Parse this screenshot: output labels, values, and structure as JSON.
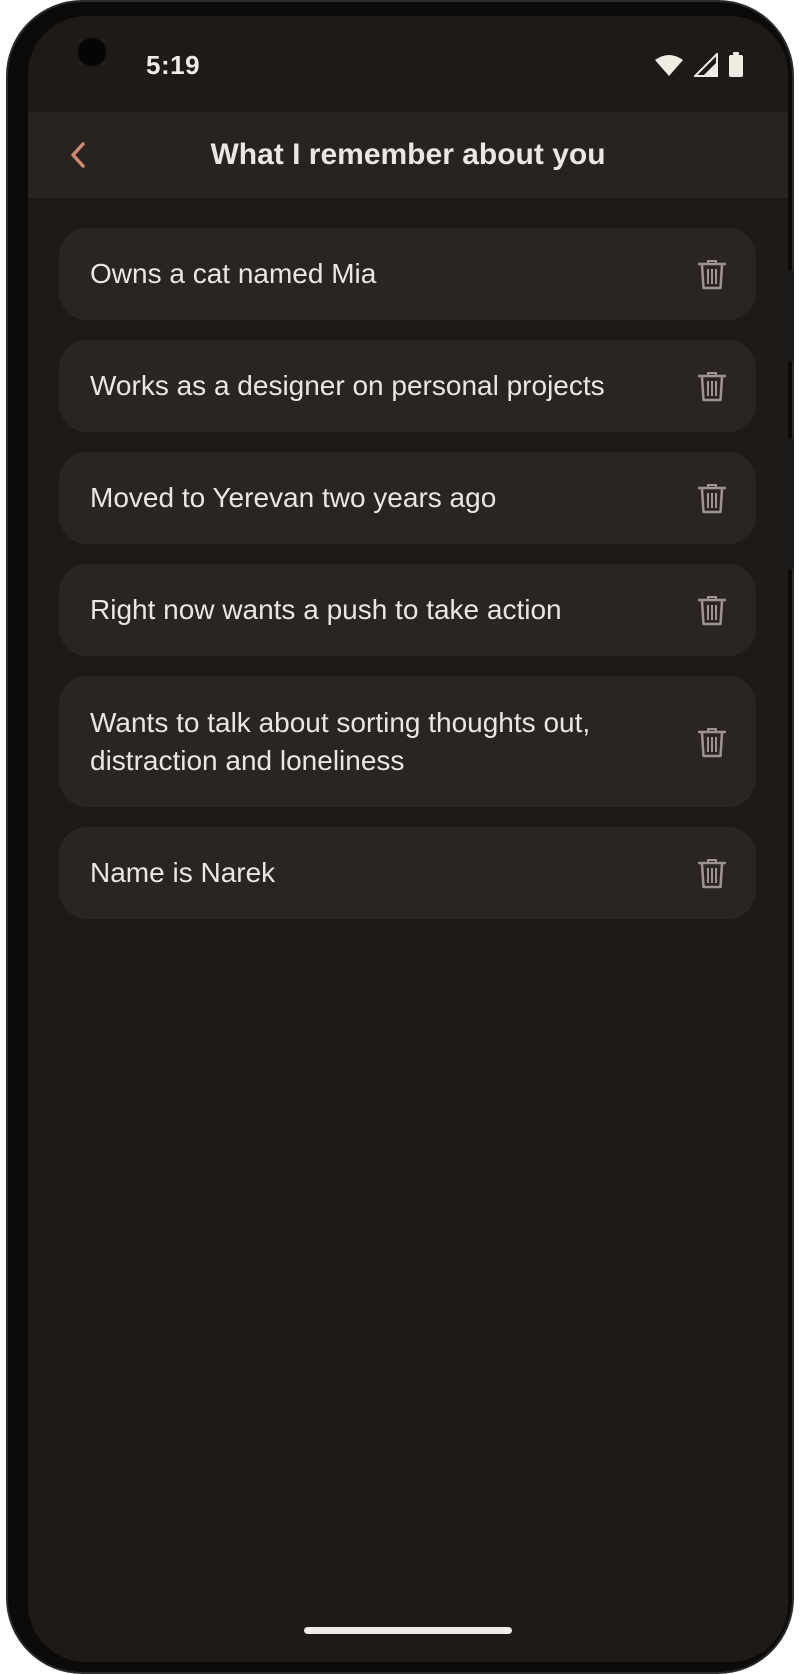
{
  "status_bar": {
    "time": "5:19",
    "icons": [
      "wifi-icon",
      "signal-icon",
      "battery-icon"
    ]
  },
  "app_bar": {
    "back_icon": "chevron-left-icon",
    "title": "What I remember about you"
  },
  "memories": [
    {
      "text": "Owns a cat named Mia",
      "action_icon": "trash-icon"
    },
    {
      "text": "Works as a designer on personal projects",
      "action_icon": "trash-icon"
    },
    {
      "text": "Moved to Yerevan two years ago",
      "action_icon": "trash-icon"
    },
    {
      "text": "Right now wants a push to take action",
      "action_icon": "trash-icon"
    },
    {
      "text": "Wants to talk about sorting thoughts out, distraction and loneliness",
      "action_icon": "trash-icon"
    },
    {
      "text": "Name is Narek",
      "action_icon": "trash-icon"
    }
  ],
  "colors": {
    "background": "#1e1a17",
    "app_bar": "#282320",
    "card": "#2a2522",
    "text": "#ece6e1",
    "accent": "#d08a6e",
    "icon": "#9d948d"
  }
}
